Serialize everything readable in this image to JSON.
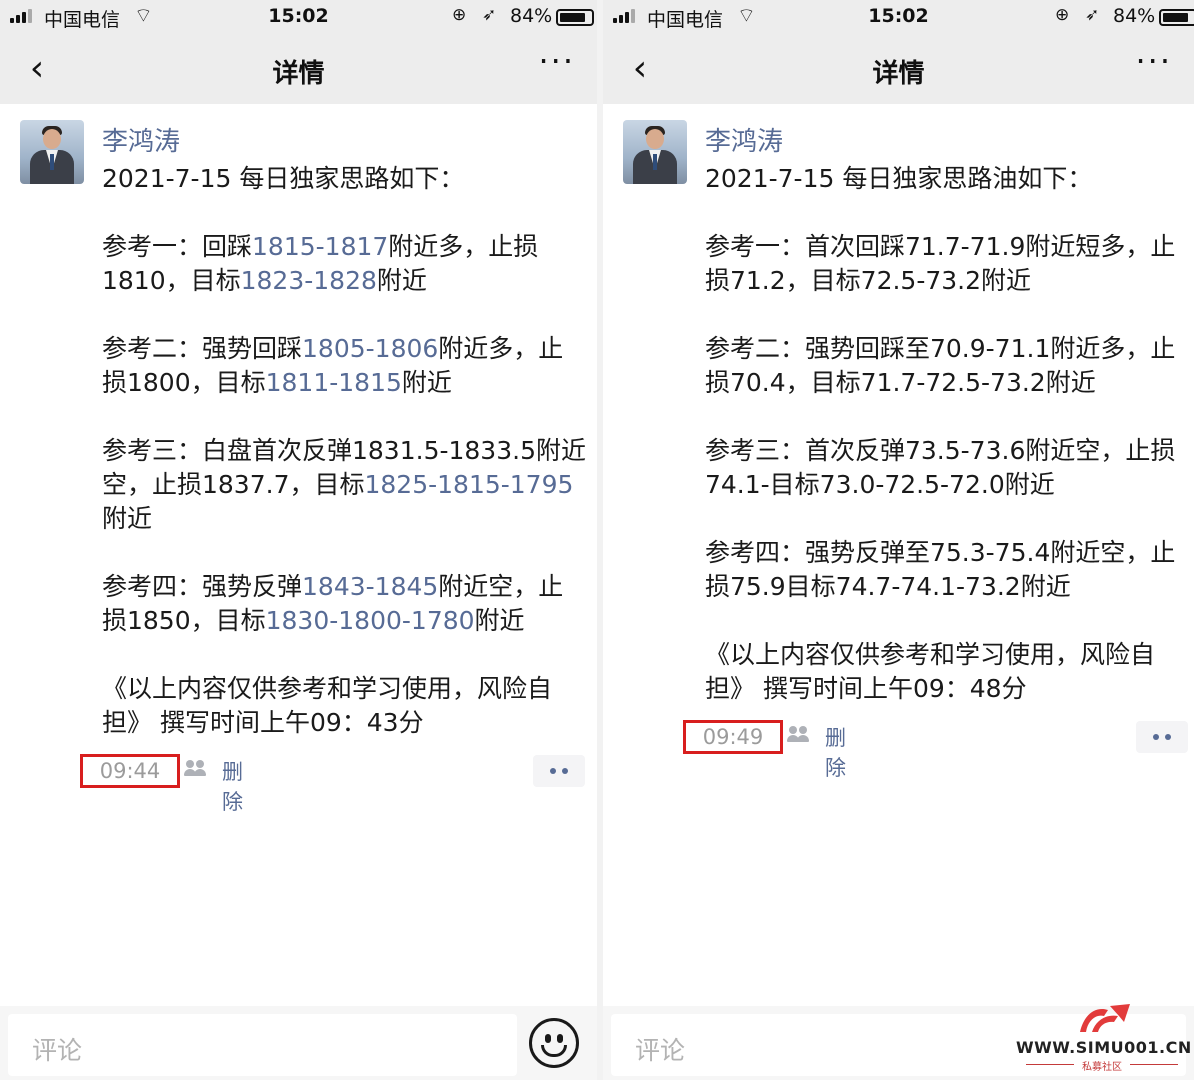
{
  "status_bar": {
    "carrier": "中国电信",
    "time": "15:02",
    "battery": "84%",
    "battery_level": 0.84,
    "signal_bars": 3
  },
  "nav": {
    "title": "详情",
    "back_icon": "chevron-left-icon",
    "more_icon": "more-dots-icon"
  },
  "posts": [
    {
      "author": "李鸿涛",
      "header": "2021-7-15  每日独家思路如下：",
      "paragraphs": [
        [
          {
            "t": "参考一：回踩",
            "h": false
          },
          {
            "t": "1815-1817",
            "h": true
          },
          {
            "t": "附近多，止损1810，目标",
            "h": false
          },
          {
            "t": "1823-1828",
            "h": true
          },
          {
            "t": "附近",
            "h": false
          }
        ],
        [
          {
            "t": "参考二：强势回踩",
            "h": false
          },
          {
            "t": "1805-1806",
            "h": true
          },
          {
            "t": "附近多，止损1800，目标",
            "h": false
          },
          {
            "t": "1811-1815",
            "h": true
          },
          {
            "t": "附近",
            "h": false
          }
        ],
        [
          {
            "t": "参考三：白盘首次反弹1831.5-1833.5附近空，止损1837.7，目标",
            "h": false
          },
          {
            "t": "1825-1815-1795",
            "h": true
          },
          {
            "t": "附近",
            "h": false
          }
        ],
        [
          {
            "t": "参考四：强势反弹",
            "h": false
          },
          {
            "t": "1843-1845",
            "h": true
          },
          {
            "t": "附近空，止损1850，目标",
            "h": false
          },
          {
            "t": "1830-1800-1780",
            "h": true
          },
          {
            "t": "附近",
            "h": false
          }
        ],
        [
          {
            "t": "《以上内容仅供参考和学习使用，风险自担》  撰写时间上午09：43分",
            "h": false
          }
        ]
      ],
      "time": "09:44",
      "delete_label": "删除",
      "comment_placeholder": "评论",
      "emoji_icon": "smiley-icon"
    },
    {
      "author": "李鸿涛",
      "header": "2021-7-15  每日独家思路油如下：",
      "paragraphs": [
        [
          {
            "t": "参考一：首次回踩71.7-71.9附近短多，止损71.2，目标72.5-73.2附近",
            "h": false
          }
        ],
        [
          {
            "t": "参考二：强势回踩至70.9-71.1附近多，止损70.4，目标71.7-72.5-73.2附近",
            "h": false
          }
        ],
        [
          {
            "t": "参考三：首次反弹73.5-73.6附近空，止损74.1-目标73.0-72.5-72.0附近",
            "h": false
          }
        ],
        [
          {
            "t": "参考四：强势反弹至75.3-75.4附近空，止损75.9目标74.7-74.1-73.2附近",
            "h": false
          }
        ],
        [
          {
            "t": "《以上内容仅供参考和学习使用，风险自担》  撰写时间上午09：48分",
            "h": false
          }
        ]
      ],
      "time": "09:49",
      "delete_label": "删除",
      "comment_placeholder": "评论"
    }
  ],
  "watermark": {
    "url": "WWW.SIMU001.CN",
    "subtitle": "私募社区"
  },
  "colors": {
    "link": "#576b95",
    "highlight_box": "#d81e1e",
    "nav_bg": "#ededed"
  }
}
